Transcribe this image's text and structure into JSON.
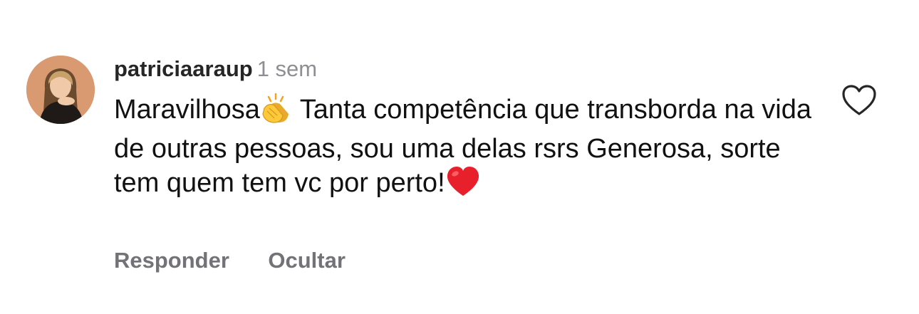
{
  "comment": {
    "username": "patriciaaraup",
    "timestamp": "1 sem",
    "text_part1": "Maravilhosa",
    "emoji1": "clapping-hands",
    "text_part2": " Tanta competência que transborda na vida de outras pessoas, sou uma delas rsrs Generosa, sorte tem quem tem vc por perto!",
    "emoji2": "red-heart",
    "liked": false
  },
  "actions": {
    "reply_label": "Responder",
    "hide_label": "Ocultar"
  },
  "colors": {
    "username": "#262626",
    "timestamp": "#8e8e93",
    "action": "#737377",
    "heart_outline": "#262626"
  }
}
